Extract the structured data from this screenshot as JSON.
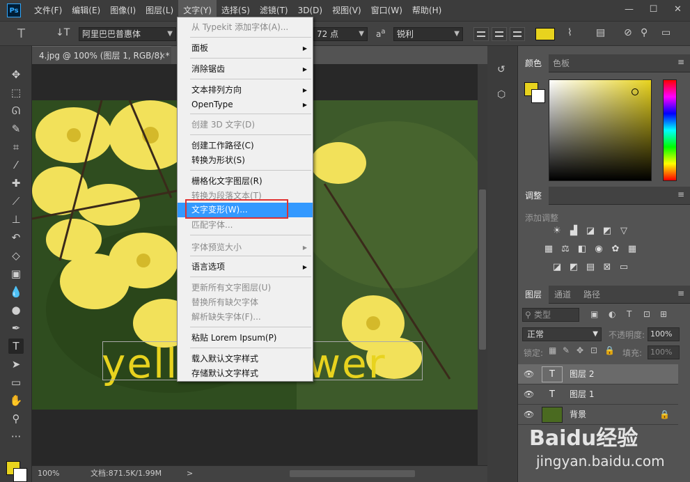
{
  "menubar": {
    "logo": "Ps",
    "items": [
      "文件(F)",
      "编辑(E)",
      "图像(I)",
      "图层(L)",
      "文字(Y)",
      "选择(S)",
      "滤镜(T)",
      "3D(D)",
      "视图(V)",
      "窗口(W)",
      "帮助(H)"
    ],
    "active_index": 4,
    "window_buttons": [
      "—",
      "☐",
      "✕"
    ]
  },
  "options_bar": {
    "font_family": "阿里巴巴普惠体",
    "font_size": "72 点",
    "antialias_label": "a",
    "antialias": "锐利",
    "text_color": "#e8d31e"
  },
  "document": {
    "tab_title": "4.jpg @ 100% (图层 1, RGB/8) *",
    "overlay_text": "yellow flower",
    "zoom": "100%",
    "doc_size": "文档:871.5K/1.99M",
    "status_arrow": ">"
  },
  "type_menu": {
    "items": [
      {
        "label": "从 Typekit 添加字体(A)...",
        "disabled": true,
        "submenu": false
      },
      {
        "label": "面板",
        "disabled": false,
        "submenu": true
      },
      {
        "label": "消除锯齿",
        "disabled": false,
        "submenu": true
      },
      {
        "label": "文本排列方向",
        "disabled": false,
        "submenu": true
      },
      {
        "label": "OpenType",
        "disabled": false,
        "submenu": true
      },
      {
        "label": "创建 3D 文字(D)",
        "disabled": true,
        "submenu": false
      },
      {
        "label": "创建工作路径(C)",
        "disabled": false,
        "submenu": false
      },
      {
        "label": "转换为形状(S)",
        "disabled": false,
        "submenu": false
      },
      {
        "label": "栅格化文字图层(R)",
        "disabled": false,
        "submenu": false
      },
      {
        "label": "转换为段落文本(T)",
        "disabled": true,
        "submenu": false
      },
      {
        "label": "文字变形(W)...",
        "disabled": false,
        "submenu": false,
        "highlighted": true
      },
      {
        "label": "匹配字体...",
        "disabled": true,
        "submenu": false
      },
      {
        "label": "字体预览大小",
        "disabled": true,
        "submenu": true
      },
      {
        "label": "语言选项",
        "disabled": false,
        "submenu": true
      },
      {
        "label": "更新所有文字图层(U)",
        "disabled": true,
        "submenu": false
      },
      {
        "label": "替换所有缺欠字体",
        "disabled": true,
        "submenu": false
      },
      {
        "label": "解析缺失字体(F)...",
        "disabled": true,
        "submenu": false
      },
      {
        "label": "粘贴 Lorem Ipsum(P)",
        "disabled": false,
        "submenu": false
      },
      {
        "label": "载入默认文字样式",
        "disabled": false,
        "submenu": false
      },
      {
        "label": "存储默认文字样式",
        "disabled": false,
        "submenu": false
      }
    ]
  },
  "color_panel": {
    "tabs": [
      "颜色",
      "色板"
    ],
    "fg": "#e8d31e",
    "bg": "#ffffff"
  },
  "adjust_panel": {
    "tab": "调整",
    "hint": "添加调整"
  },
  "layers_panel": {
    "tabs": [
      "图层",
      "通道",
      "路径"
    ],
    "filter_label": "类型",
    "blend_mode": "正常",
    "opacity_label": "不透明度:",
    "opacity": "100%",
    "lock_label": "锁定:",
    "fill_label": "填充:",
    "fill": "100%",
    "layers": [
      {
        "name": "图层 2",
        "kind": "text",
        "selected": true
      },
      {
        "name": "图层 1",
        "kind": "text",
        "selected": false
      },
      {
        "name": "背景",
        "kind": "image",
        "selected": false,
        "locked": true
      }
    ]
  },
  "watermark": {
    "brand": "Baidu经验",
    "url": "jingyan.baidu.com"
  },
  "icons": [
    "move-icon",
    "marquee-icon",
    "lasso-icon",
    "quick-select-icon",
    "crop-icon",
    "eyedropper-icon",
    "healing-icon",
    "brush-icon",
    "stamp-icon",
    "history-brush-icon",
    "eraser-icon",
    "gradient-icon",
    "blur-icon",
    "dodge-icon",
    "pen-icon",
    "type-icon",
    "path-select-icon",
    "rectangle-icon",
    "hand-icon",
    "zoom-icon",
    "more-icon"
  ]
}
